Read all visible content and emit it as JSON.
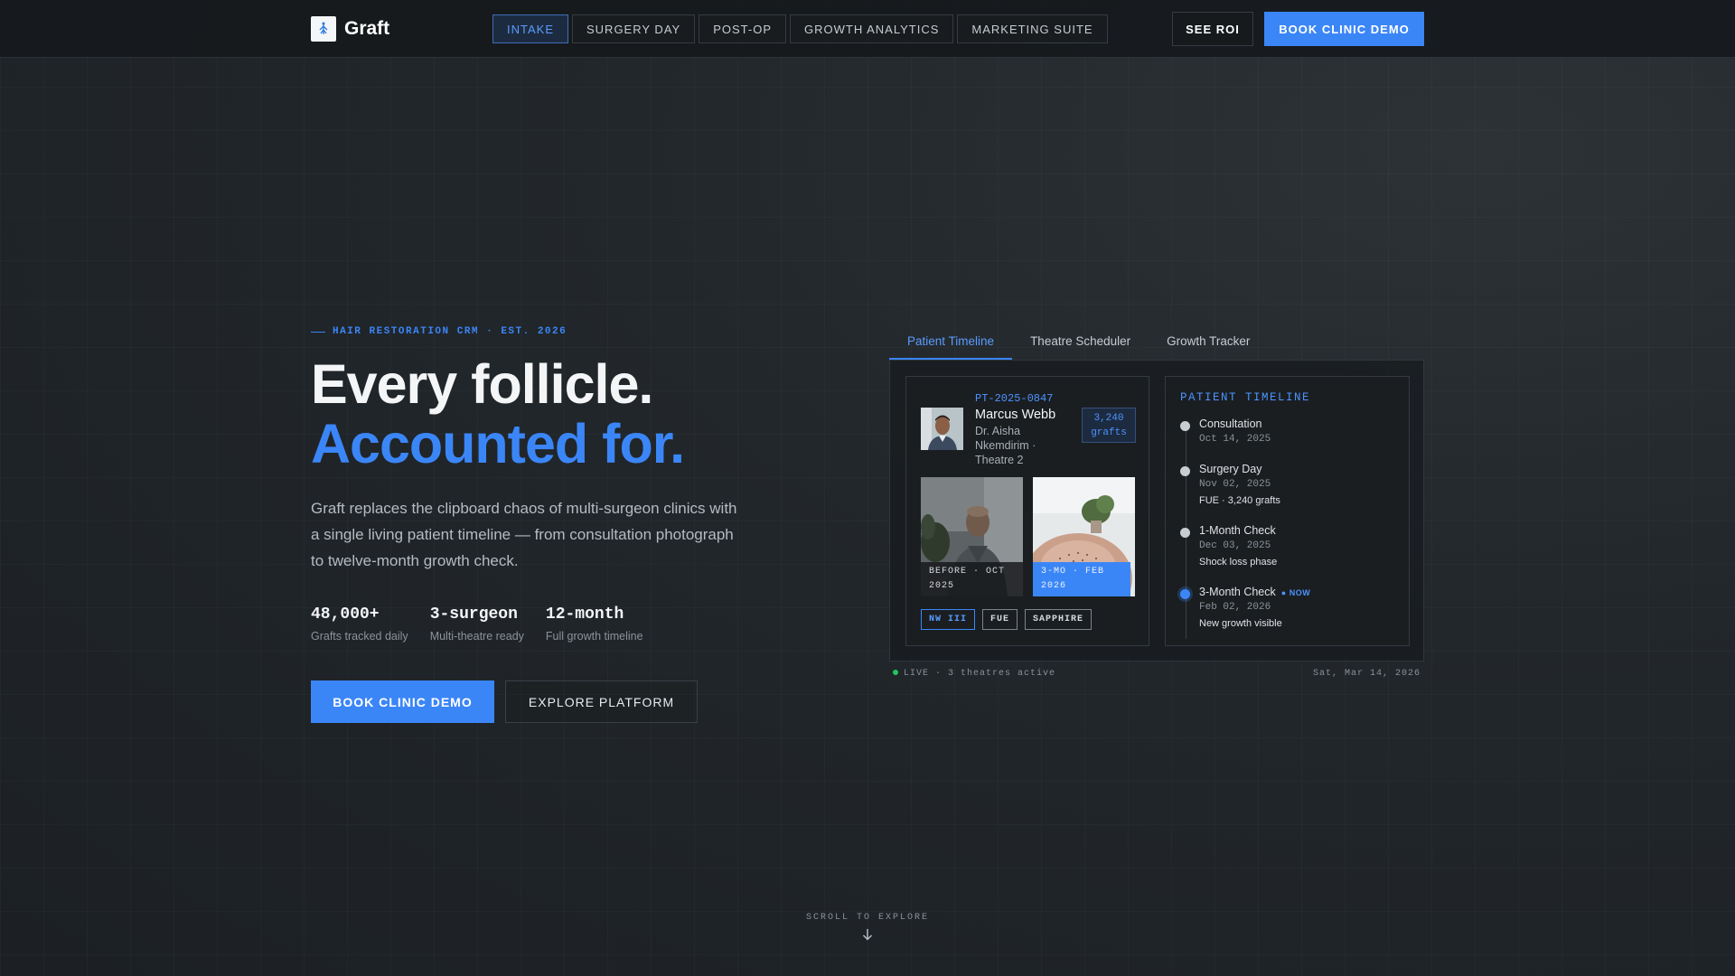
{
  "nav": {
    "brand": "Graft",
    "tabs": [
      {
        "label": "INTAKE",
        "active": true
      },
      {
        "label": "SURGERY DAY",
        "active": false
      },
      {
        "label": "POST-OP",
        "active": false
      },
      {
        "label": "GROWTH ANALYTICS",
        "active": false
      },
      {
        "label": "MARKETING SUITE",
        "active": false
      }
    ],
    "see_roi": "SEE ROI",
    "book_demo": "BOOK CLINIC DEMO"
  },
  "hero": {
    "eyebrow": "HAIR RESTORATION CRM · EST. 2026",
    "headline_line1": "Every follicle.",
    "headline_line2": "Accounted for.",
    "lede": "Graft replaces the clipboard chaos of multi-surgeon clinics with a single living patient timeline — from consultation photograph to twelve-month growth check.",
    "stats": [
      {
        "value": "48,000+",
        "label": "Grafts tracked daily"
      },
      {
        "value": "3-surgeon",
        "label": "Multi-theatre ready"
      },
      {
        "value": "12-month",
        "label": "Full growth timeline"
      }
    ],
    "primary_cta": "BOOK CLINIC DEMO",
    "secondary_cta": "EXPLORE PLATFORM"
  },
  "panel": {
    "tabs": [
      {
        "label": "Patient Timeline",
        "active": true
      },
      {
        "label": "Theatre Scheduler",
        "active": false
      },
      {
        "label": "Growth Tracker",
        "active": false
      }
    ],
    "patient": {
      "id": "PT-2025-0847",
      "name": "Marcus Webb",
      "doctor": "Dr. Aisha Nkemdirim · Theatre 2",
      "grafts_line1": "3,240",
      "grafts_line2": "grafts",
      "before_caption": "BEFORE · OCT 2025",
      "after_caption": "3-MO · FEB 2026",
      "tags": [
        {
          "label": "NW III",
          "highlight": true
        },
        {
          "label": "FUE",
          "highlight": false
        },
        {
          "label": "SAPPHIRE",
          "highlight": false
        }
      ]
    },
    "timeline": {
      "title": "PATIENT TIMELINE",
      "now_label": "● NOW",
      "items": [
        {
          "name": "Consultation",
          "date": "Oct 14, 2025",
          "note": ""
        },
        {
          "name": "Surgery Day",
          "date": "Nov 02, 2025",
          "note": "FUE · 3,240 grafts"
        },
        {
          "name": "1-Month Check",
          "date": "Dec 03, 2025",
          "note": "Shock loss phase"
        },
        {
          "name": "3-Month Check",
          "date": "Feb 02, 2026",
          "note": "New growth visible",
          "current": true
        }
      ]
    },
    "status_left": "LIVE · 3 theatres active",
    "status_right": "Sat, Mar 14, 2026"
  },
  "scroll_hint": "SCROLL TO EXPLORE",
  "colors": {
    "accent": "#3b86f7",
    "background": "#1f2428",
    "live": "#22c55e"
  }
}
